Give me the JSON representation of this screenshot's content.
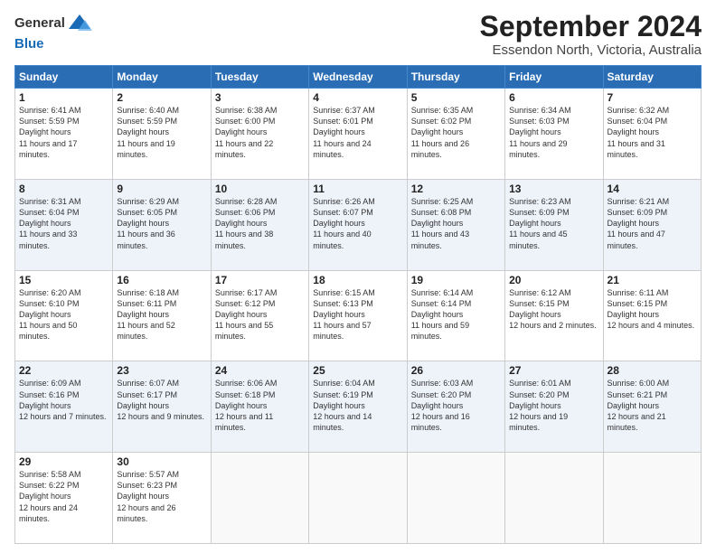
{
  "logo": {
    "line1": "General",
    "line2": "Blue"
  },
  "title": "September 2024",
  "subtitle": "Essendon North, Victoria, Australia",
  "weekdays": [
    "Sunday",
    "Monday",
    "Tuesday",
    "Wednesday",
    "Thursday",
    "Friday",
    "Saturday"
  ],
  "weeks": [
    [
      {
        "day": "1",
        "rise": "6:41 AM",
        "set": "5:59 PM",
        "hours": "11 hours and 17 minutes."
      },
      {
        "day": "2",
        "rise": "6:40 AM",
        "set": "5:59 PM",
        "hours": "11 hours and 19 minutes."
      },
      {
        "day": "3",
        "rise": "6:38 AM",
        "set": "6:00 PM",
        "hours": "11 hours and 22 minutes."
      },
      {
        "day": "4",
        "rise": "6:37 AM",
        "set": "6:01 PM",
        "hours": "11 hours and 24 minutes."
      },
      {
        "day": "5",
        "rise": "6:35 AM",
        "set": "6:02 PM",
        "hours": "11 hours and 26 minutes."
      },
      {
        "day": "6",
        "rise": "6:34 AM",
        "set": "6:03 PM",
        "hours": "11 hours and 29 minutes."
      },
      {
        "day": "7",
        "rise": "6:32 AM",
        "set": "6:04 PM",
        "hours": "11 hours and 31 minutes."
      }
    ],
    [
      {
        "day": "8",
        "rise": "6:31 AM",
        "set": "6:04 PM",
        "hours": "11 hours and 33 minutes."
      },
      {
        "day": "9",
        "rise": "6:29 AM",
        "set": "6:05 PM",
        "hours": "11 hours and 36 minutes."
      },
      {
        "day": "10",
        "rise": "6:28 AM",
        "set": "6:06 PM",
        "hours": "11 hours and 38 minutes."
      },
      {
        "day": "11",
        "rise": "6:26 AM",
        "set": "6:07 PM",
        "hours": "11 hours and 40 minutes."
      },
      {
        "day": "12",
        "rise": "6:25 AM",
        "set": "6:08 PM",
        "hours": "11 hours and 43 minutes."
      },
      {
        "day": "13",
        "rise": "6:23 AM",
        "set": "6:09 PM",
        "hours": "11 hours and 45 minutes."
      },
      {
        "day": "14",
        "rise": "6:21 AM",
        "set": "6:09 PM",
        "hours": "11 hours and 47 minutes."
      }
    ],
    [
      {
        "day": "15",
        "rise": "6:20 AM",
        "set": "6:10 PM",
        "hours": "11 hours and 50 minutes."
      },
      {
        "day": "16",
        "rise": "6:18 AM",
        "set": "6:11 PM",
        "hours": "11 hours and 52 minutes."
      },
      {
        "day": "17",
        "rise": "6:17 AM",
        "set": "6:12 PM",
        "hours": "11 hours and 55 minutes."
      },
      {
        "day": "18",
        "rise": "6:15 AM",
        "set": "6:13 PM",
        "hours": "11 hours and 57 minutes."
      },
      {
        "day": "19",
        "rise": "6:14 AM",
        "set": "6:14 PM",
        "hours": "11 hours and 59 minutes."
      },
      {
        "day": "20",
        "rise": "6:12 AM",
        "set": "6:15 PM",
        "hours": "12 hours and 2 minutes."
      },
      {
        "day": "21",
        "rise": "6:11 AM",
        "set": "6:15 PM",
        "hours": "12 hours and 4 minutes."
      }
    ],
    [
      {
        "day": "22",
        "rise": "6:09 AM",
        "set": "6:16 PM",
        "hours": "12 hours and 7 minutes."
      },
      {
        "day": "23",
        "rise": "6:07 AM",
        "set": "6:17 PM",
        "hours": "12 hours and 9 minutes."
      },
      {
        "day": "24",
        "rise": "6:06 AM",
        "set": "6:18 PM",
        "hours": "12 hours and 11 minutes."
      },
      {
        "day": "25",
        "rise": "6:04 AM",
        "set": "6:19 PM",
        "hours": "12 hours and 14 minutes."
      },
      {
        "day": "26",
        "rise": "6:03 AM",
        "set": "6:20 PM",
        "hours": "12 hours and 16 minutes."
      },
      {
        "day": "27",
        "rise": "6:01 AM",
        "set": "6:20 PM",
        "hours": "12 hours and 19 minutes."
      },
      {
        "day": "28",
        "rise": "6:00 AM",
        "set": "6:21 PM",
        "hours": "12 hours and 21 minutes."
      }
    ],
    [
      {
        "day": "29",
        "rise": "5:58 AM",
        "set": "6:22 PM",
        "hours": "12 hours and 24 minutes."
      },
      {
        "day": "30",
        "rise": "5:57 AM",
        "set": "6:23 PM",
        "hours": "12 hours and 26 minutes."
      },
      null,
      null,
      null,
      null,
      null
    ]
  ]
}
